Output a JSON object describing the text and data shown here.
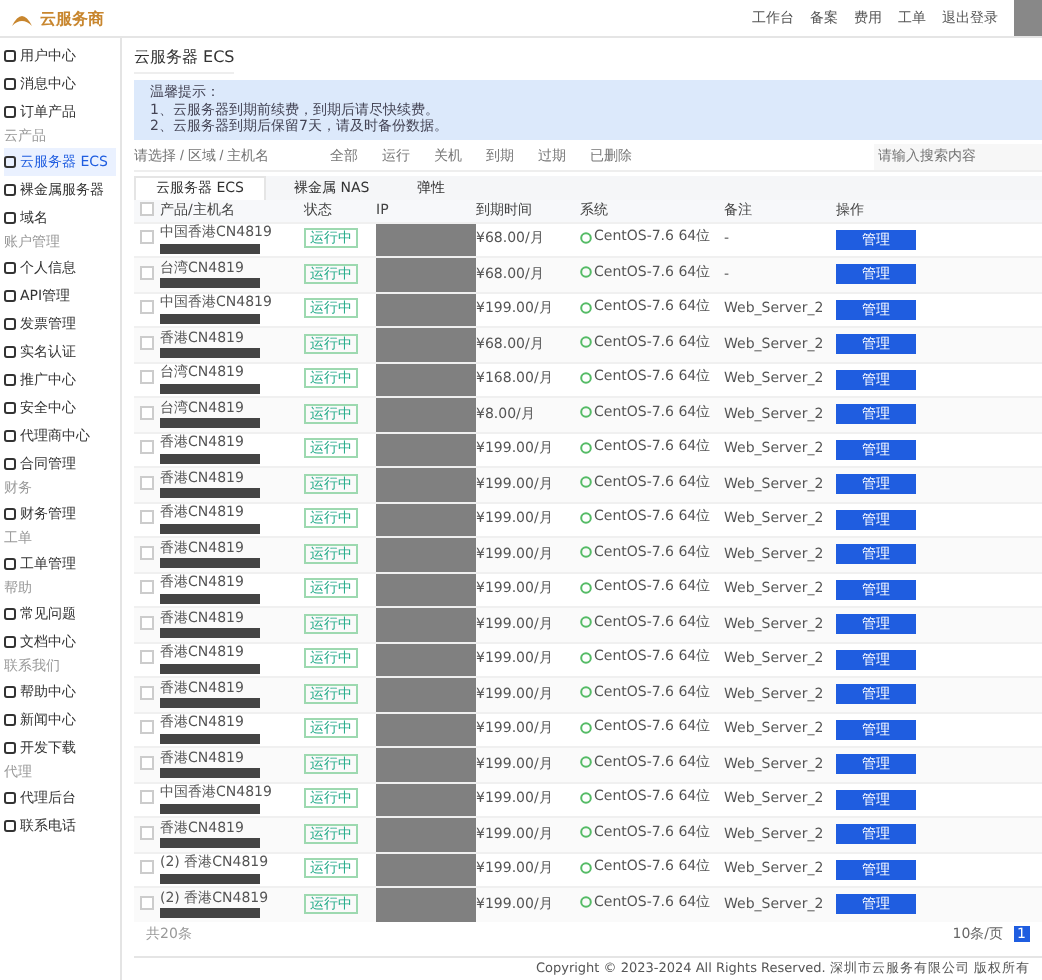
{
  "header": {
    "logo": "云服务商",
    "links": [
      "工作台",
      "备案",
      "费用",
      "工单",
      "退出登录"
    ]
  },
  "sidebar": {
    "sections": [
      {
        "items": [
          {
            "label": "用户中心",
            "selected": false
          },
          {
            "label": "消息中心",
            "selected": false
          },
          {
            "label": "订单产品",
            "selected": false
          }
        ]
      },
      {
        "title": "云产品",
        "items": [
          {
            "label": "云服务器 ECS",
            "selected": true
          },
          {
            "label": "裸金属服务器",
            "selected": false
          },
          {
            "label": "域名",
            "selected": false
          }
        ]
      },
      {
        "title": "账户管理",
        "items": [
          {
            "label": "个人信息",
            "selected": false
          },
          {
            "label": "API管理",
            "selected": false
          },
          {
            "label": "发票管理",
            "selected": false
          },
          {
            "label": "实名认证",
            "selected": false
          },
          {
            "label": "推广中心",
            "selected": false
          },
          {
            "label": "安全中心",
            "selected": false
          },
          {
            "label": "代理商中心",
            "selected": false
          },
          {
            "label": "合同管理",
            "selected": false
          }
        ]
      },
      {
        "title": "财务",
        "items": [
          {
            "label": "财务管理",
            "selected": false
          }
        ]
      },
      {
        "title": "工单",
        "items": [
          {
            "label": "工单管理",
            "selected": false
          }
        ]
      },
      {
        "title": "帮助",
        "items": [
          {
            "label": "常见问题",
            "selected": false
          },
          {
            "label": "文档中心",
            "selected": false
          }
        ]
      },
      {
        "title": "联系我们",
        "items": [
          {
            "label": "帮助中心",
            "selected": false
          },
          {
            "label": "新闻中心",
            "selected": false
          },
          {
            "label": "开发下载",
            "selected": false
          }
        ]
      },
      {
        "title": "代理",
        "items": [
          {
            "label": "代理后台",
            "selected": false
          },
          {
            "label": "联系电话",
            "selected": false
          }
        ]
      }
    ]
  },
  "page_title": "云服务器 ECS",
  "notice": {
    "title": "温馨提示：",
    "lines": [
      "1、云服务器到期前续费，到期后请尽快续费。",
      "2、云服务器到期后保留7天，请及时备份数据。"
    ]
  },
  "filter": {
    "placeholder": "请选择 / 区域 / 主机名",
    "chips": [
      "全部",
      "运行",
      "关机",
      "到期",
      "过期",
      "已删除"
    ],
    "search_placeholder": "请输入搜索内容"
  },
  "tabs": [
    {
      "label": "云服务器 ECS",
      "selected": true
    },
    {
      "label": "裸金属 NAS",
      "selected": false
    },
    {
      "label": "弹性",
      "selected": false
    }
  ],
  "table": {
    "columns": [
      "产品/主机名",
      "状态",
      "IP",
      "到期时间",
      "系统",
      "备注",
      "操作"
    ],
    "all_checked": false,
    "rows": [
      {
        "checked": false,
        "name": "中国香港CN4819",
        "status": "运行中",
        "expiry": "¥68.00/月",
        "os": "CentOS-7.6 64位",
        "remark": "-",
        "action": "管理"
      },
      {
        "checked": false,
        "name": "台湾CN4819",
        "status": "运行中",
        "expiry": "¥68.00/月",
        "os": "CentOS-7.6 64位",
        "remark": "-",
        "action": "管理"
      },
      {
        "checked": false,
        "name": "中国香港CN4819",
        "status": "运行中",
        "expiry": "¥199.00/月",
        "os": "CentOS-7.6 64位",
        "remark": "Web_Server_2",
        "action": "管理"
      },
      {
        "checked": false,
        "name": "香港CN4819",
        "status": "运行中",
        "expiry": "¥68.00/月",
        "os": "CentOS-7.6 64位",
        "remark": "Web_Server_2",
        "action": "管理"
      },
      {
        "checked": false,
        "name": "台湾CN4819",
        "status": "运行中",
        "expiry": "¥168.00/月",
        "os": "CentOS-7.6 64位",
        "remark": "Web_Server_2",
        "action": "管理"
      },
      {
        "checked": false,
        "name": "台湾CN4819",
        "status": "运行中",
        "expiry": "¥8.00/月",
        "os": "CentOS-7.6 64位",
        "remark": "Web_Server_2",
        "action": "管理"
      },
      {
        "checked": false,
        "name": "香港CN4819",
        "status": "运行中",
        "expiry": "¥199.00/月",
        "os": "CentOS-7.6 64位",
        "remark": "Web_Server_2",
        "action": "管理"
      },
      {
        "checked": false,
        "name": "香港CN4819",
        "status": "运行中",
        "expiry": "¥199.00/月",
        "os": "CentOS-7.6 64位",
        "remark": "Web_Server_2",
        "action": "管理"
      },
      {
        "checked": false,
        "name": "香港CN4819",
        "status": "运行中",
        "expiry": "¥199.00/月",
        "os": "CentOS-7.6 64位",
        "remark": "Web_Server_2",
        "action": "管理"
      },
      {
        "checked": false,
        "name": "香港CN4819",
        "status": "运行中",
        "expiry": "¥199.00/月",
        "os": "CentOS-7.6 64位",
        "remark": "Web_Server_2",
        "action": "管理"
      },
      {
        "checked": false,
        "name": "香港CN4819",
        "status": "运行中",
        "expiry": "¥199.00/月",
        "os": "CentOS-7.6 64位",
        "remark": "Web_Server_2",
        "action": "管理"
      },
      {
        "checked": false,
        "name": "香港CN4819",
        "status": "运行中",
        "expiry": "¥199.00/月",
        "os": "CentOS-7.6 64位",
        "remark": "Web_Server_2",
        "action": "管理"
      },
      {
        "checked": false,
        "name": "香港CN4819",
        "status": "运行中",
        "expiry": "¥199.00/月",
        "os": "CentOS-7.6 64位",
        "remark": "Web_Server_2",
        "action": "管理"
      },
      {
        "checked": false,
        "name": "香港CN4819",
        "status": "运行中",
        "expiry": "¥199.00/月",
        "os": "CentOS-7.6 64位",
        "remark": "Web_Server_2",
        "action": "管理"
      },
      {
        "checked": false,
        "name": "香港CN4819",
        "status": "运行中",
        "expiry": "¥199.00/月",
        "os": "CentOS-7.6 64位",
        "remark": "Web_Server_2",
        "action": "管理"
      },
      {
        "checked": false,
        "name": "香港CN4819",
        "status": "运行中",
        "expiry": "¥199.00/月",
        "os": "CentOS-7.6 64位",
        "remark": "Web_Server_2",
        "action": "管理"
      },
      {
        "checked": false,
        "name": "中国香港CN4819",
        "status": "运行中",
        "expiry": "¥199.00/月",
        "os": "CentOS-7.6 64位",
        "remark": "Web_Server_2",
        "action": "管理"
      },
      {
        "checked": false,
        "name": "香港CN4819",
        "status": "运行中",
        "expiry": "¥199.00/月",
        "os": "CentOS-7.6 64位",
        "remark": "Web_Server_2",
        "action": "管理"
      },
      {
        "checked": false,
        "name": "(2) 香港CN4819",
        "status": "运行中",
        "expiry": "¥199.00/月",
        "os": "CentOS-7.6 64位",
        "remark": "Web_Server_2",
        "action": "管理"
      },
      {
        "checked": false,
        "name": "(2) 香港CN4819",
        "status": "运行中",
        "expiry": "¥199.00/月",
        "os": "CentOS-7.6 64位",
        "remark": "Web_Server_2",
        "action": "管理"
      }
    ]
  },
  "table_footer": "共20条",
  "pagination": {
    "size": "10条/页",
    "pages": [
      {
        "label": "1",
        "selected": true
      }
    ]
  },
  "footer": "Copyright © 2023-2024 All Rights Reserved. 深圳市云服务有限公司 版权所有"
}
